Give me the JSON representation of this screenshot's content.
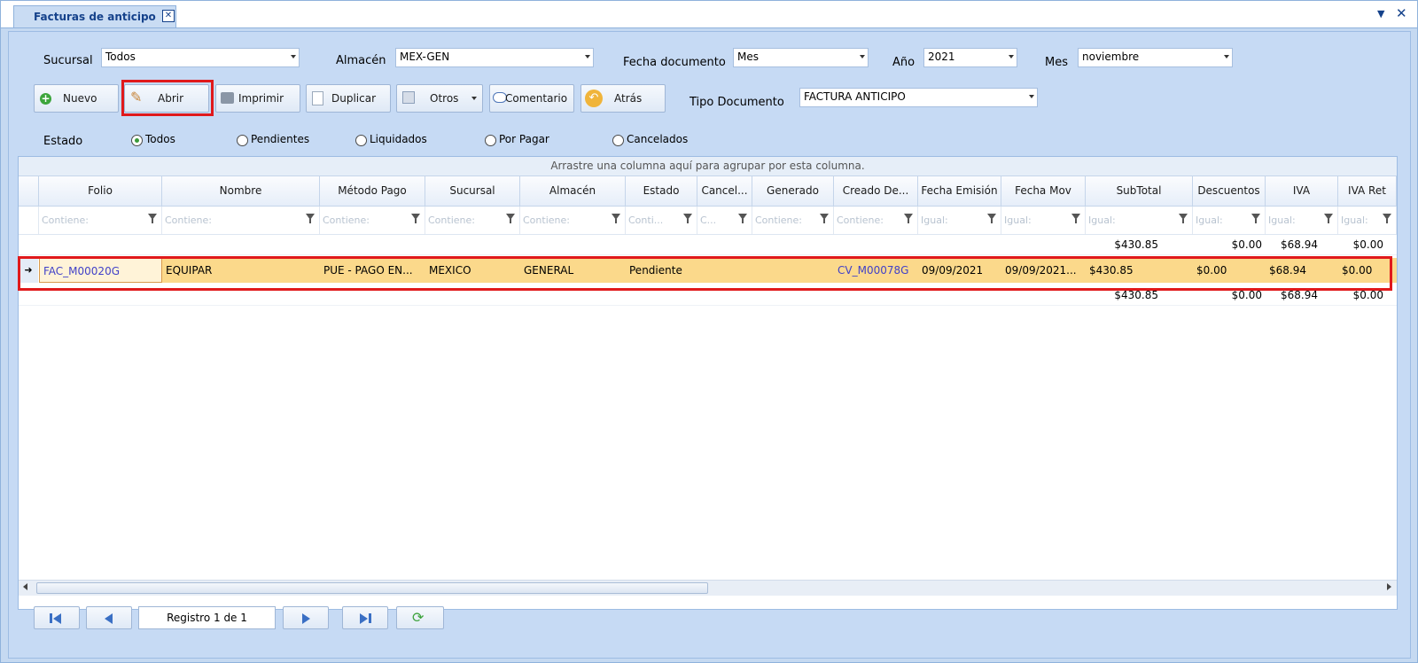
{
  "tab": {
    "title": "Facturas de anticipo",
    "close": "✕"
  },
  "window_controls": {
    "menu": "▼",
    "close": "✕"
  },
  "filters": {
    "sucursal_label": "Sucursal",
    "sucursal_value": "Todos",
    "almacen_label": "Almacén",
    "almacen_value": "MEX-GEN",
    "fecha_label": "Fecha documento",
    "fecha_value": "Mes",
    "anio_label": "Año",
    "anio_value": "2021",
    "mes_label": "Mes",
    "mes_value": "noviembre",
    "tipo_label": "Tipo Documento",
    "tipo_value": "FACTURA ANTICIPO"
  },
  "toolbar": {
    "nuevo": "Nuevo",
    "abrir": "Abrir",
    "imprimir": "Imprimir",
    "duplicar": "Duplicar",
    "otros": "Otros",
    "comentario": "Comentario",
    "atras": "Atrás"
  },
  "estado": {
    "label": "Estado",
    "options": [
      "Todos",
      "Pendientes",
      "Liquidados",
      "Por Pagar",
      "Cancelados"
    ],
    "selected": "Todos"
  },
  "grid": {
    "group_hint": "Arrastre una columna aquí para agrupar por esta columna.",
    "columns": [
      "Folio",
      "Nombre",
      "Método Pago",
      "Sucursal",
      "Almacén",
      "Estado",
      "Cancel...",
      "Generado",
      "Creado De...",
      "Fecha Emisión",
      "Fecha Mov",
      "SubTotal",
      "Descuentos",
      "IVA",
      "IVA Ret"
    ],
    "filter_placeholders": [
      "Contiene:",
      "Contiene:",
      "Contiene:",
      "Contiene:",
      "Contiene:",
      "Conti...",
      "C...",
      "Contiene:",
      "Contiene:",
      "Igual:",
      "Igual:",
      "Igual:",
      "Igual:",
      "Igual:",
      "Igual:"
    ],
    "top_summary": {
      "subtotal": "$430.85",
      "descuentos": "$0.00",
      "iva": "$68.94",
      "iva_ret": "$0.00"
    },
    "row": {
      "indicator": "➜",
      "folio": "FAC_M00020G",
      "nombre": "EQUIPAR",
      "metodo_pago": "PUE - PAGO EN...",
      "sucursal": "MEXICO",
      "almacen": "GENERAL",
      "estado": "Pendiente",
      "cancel": "",
      "generado": "",
      "creado_de": "CV_M00078G",
      "fecha_emision": "09/09/2021",
      "fecha_mov": "09/09/2021...",
      "subtotal": "$430.85",
      "descuentos": "$0.00",
      "iva": "$68.94",
      "iva_ret": "$0.00"
    },
    "bottom_summary": {
      "subtotal": "$430.85",
      "descuentos": "$0.00",
      "iva": "$68.94",
      "iva_ret": "$0.00"
    }
  },
  "pager": {
    "registro": "Registro  1  de  1"
  },
  "colors": {
    "highlight": "#e0191b",
    "selected_row": "#fbd98b",
    "link": "#4141c8"
  }
}
